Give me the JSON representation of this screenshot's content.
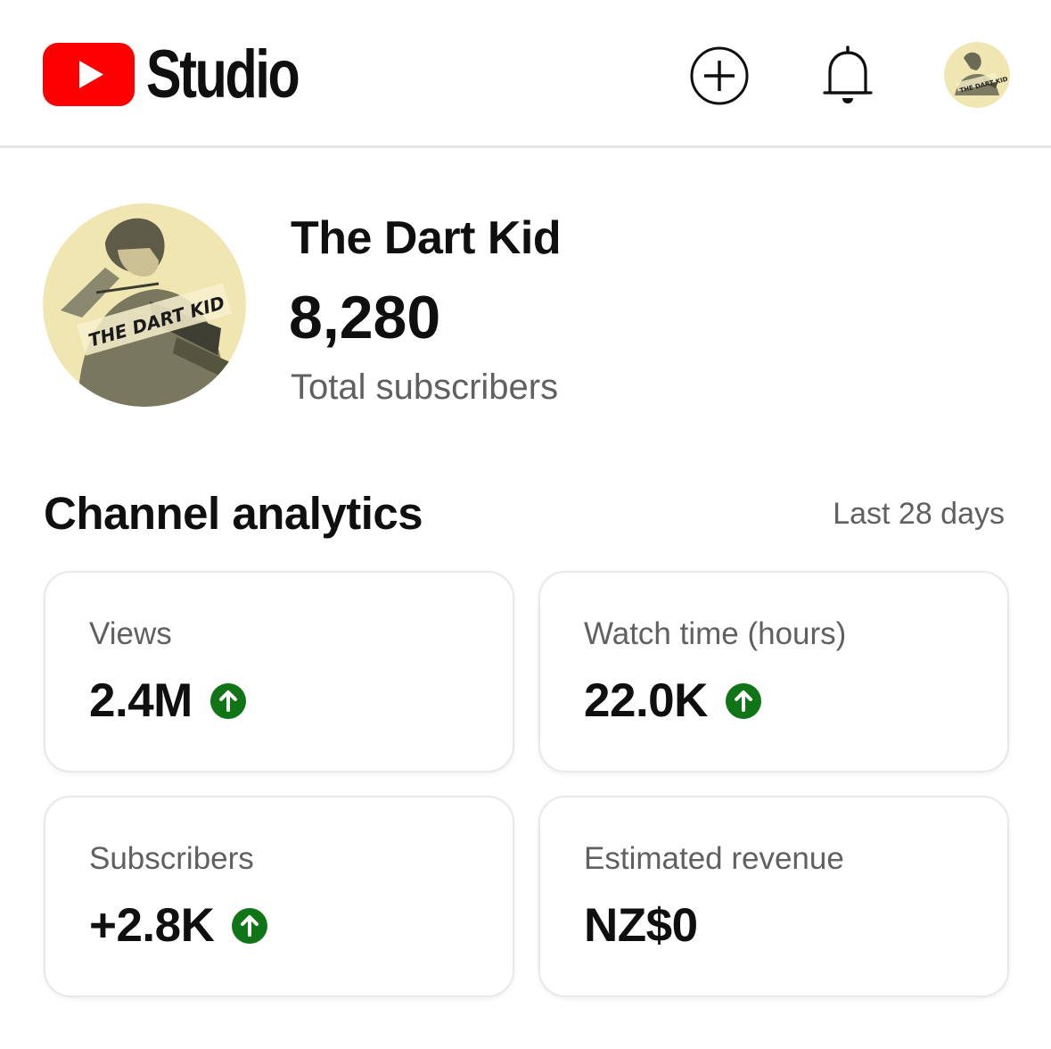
{
  "header": {
    "logo_text": "Studio",
    "brand_color": "#FF0000",
    "actions": [
      {
        "name": "create",
        "icon": "plus-circle-icon"
      },
      {
        "name": "notifications",
        "icon": "bell-icon"
      },
      {
        "name": "account",
        "icon": "avatar"
      }
    ]
  },
  "channel": {
    "name": "The Dart Kid",
    "subscriber_count": "8,280",
    "subscriber_label": "Total subscribers",
    "avatar_text": "THE DART KID"
  },
  "analytics": {
    "title": "Channel analytics",
    "period": "Last 28 days",
    "up_color": "#107516",
    "cards": [
      {
        "label": "Views",
        "value": "2.4M",
        "trend": "up"
      },
      {
        "label": "Watch time (hours)",
        "value": "22.0K",
        "trend": "up"
      },
      {
        "label": "Subscribers",
        "value": "+2.8K",
        "trend": "up"
      },
      {
        "label": "Estimated revenue",
        "value": "NZ$0",
        "trend": "none"
      }
    ]
  }
}
